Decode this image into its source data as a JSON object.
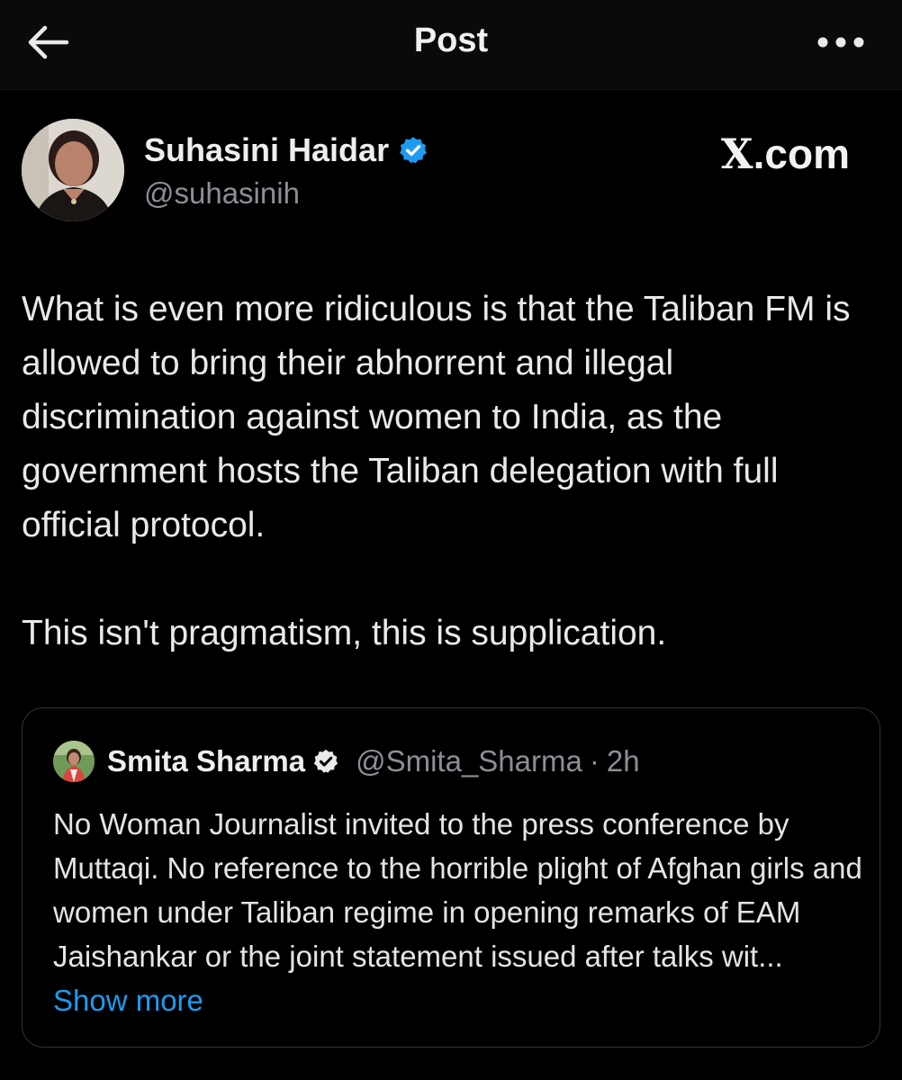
{
  "header": {
    "title": "Post",
    "back_icon": "arrow-left-icon",
    "more_icon": "more-horizontal-icon"
  },
  "author": {
    "name": "Suhasini Haidar",
    "handle": "@suhasinih",
    "verified_icon": "verified-badge-icon",
    "verified_color": "#1d9bf0"
  },
  "source": {
    "logo_letter": "X",
    "logo_suffix": ".com"
  },
  "post": {
    "paragraph_1": "What is even more ridiculous is that the Taliban FM is allowed to bring their abhorrent and illegal discrimination against women to India, as the government hosts the Taliban delegation with full official protocol.",
    "paragraph_2": "This isn't pragmatism, this is supplication."
  },
  "quote": {
    "name": "Smita Sharma",
    "handle": "@Smita_Sharma",
    "separator": "·",
    "time": "2h",
    "text": "No Woman Journalist invited to the press conference by Muttaqi. No reference to the horrible plight of Afghan girls and women under Taliban regime in opening remarks of EAM Jaishankar or the joint statement issued after talks wit...",
    "show_more": "Show more",
    "link_color": "#1d9bf0"
  }
}
